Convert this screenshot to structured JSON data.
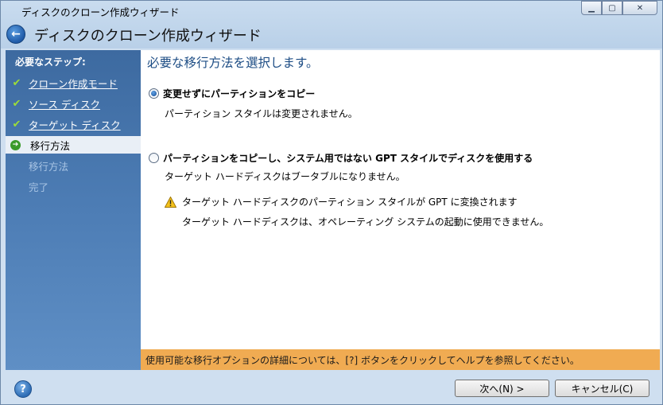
{
  "window": {
    "title": "ディスクのクローン作成ウィザード",
    "header_title": "ディスクのクローン作成ウィザード"
  },
  "sidebar": {
    "heading": "必要なステップ:",
    "items": [
      {
        "label": "クローン作成モード",
        "state": "done"
      },
      {
        "label": "ソース ディスク",
        "state": "done"
      },
      {
        "label": "ターゲット ディスク",
        "state": "done"
      },
      {
        "label": "移行方法",
        "state": "current"
      },
      {
        "label": "移行方法",
        "state": "pending"
      },
      {
        "label": "完了",
        "state": "pending"
      }
    ]
  },
  "main": {
    "title": "必要な移行方法を選択します。",
    "options": [
      {
        "label": "変更せずにパーティションをコピー",
        "description": "パーティション スタイルは変更されません。",
        "selected": true
      },
      {
        "label": "パーティションをコピーし、システム用ではない GPT スタイルでディスクを使用する",
        "description": "ターゲット ハードディスクはブータブルになりません。",
        "selected": false
      }
    ],
    "warning": {
      "line1": "ターゲット ハードディスクのパーティション スタイルが GPT に変換されます",
      "line2": "ターゲット ハードディスクは、オペレーティング システムの起動に使用できません。"
    }
  },
  "helpbar": {
    "text": "使用可能な移行オプションの詳細については、[?] ボタンをクリックしてヘルプを参照してください。"
  },
  "footer": {
    "help_label": "?",
    "next_label": "次へ(N) >",
    "cancel_label": "キャンセル(C)"
  },
  "colors": {
    "sidebar_top": "#3d6aa0",
    "helpbar": "#f0ab52",
    "title_text": "#1c4c84"
  }
}
